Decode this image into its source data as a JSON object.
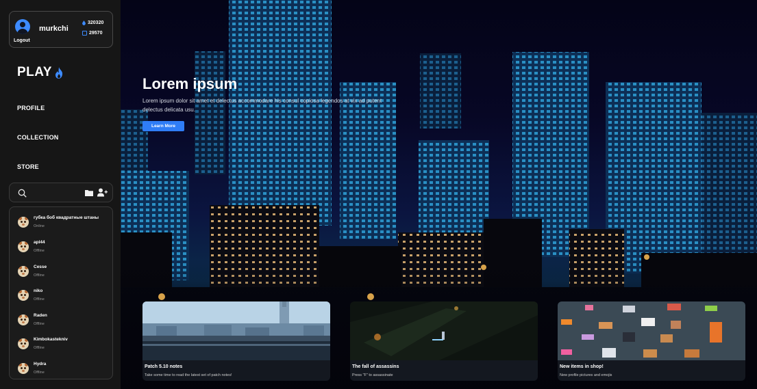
{
  "user": {
    "username": "murkchi",
    "logout_label": "Logout",
    "currency_drops": "320320",
    "currency_coins": "29570"
  },
  "logo": {
    "text": "PLAY"
  },
  "nav": {
    "profile": "PROFILE",
    "collection": "COLLECTION",
    "store": "STORE"
  },
  "search": {
    "placeholder": "",
    "value": ""
  },
  "friends": [
    {
      "name": "губка боб квадратные штаны",
      "status": "Online"
    },
    {
      "name": "apl44",
      "status": "Offline"
    },
    {
      "name": "Cesse",
      "status": "Offline"
    },
    {
      "name": "niko",
      "status": "Offline"
    },
    {
      "name": "Raden",
      "status": "Offline"
    },
    {
      "name": "Kimbokastekniv",
      "status": "Offline"
    },
    {
      "name": "Hydra",
      "status": "Offline"
    }
  ],
  "hero": {
    "title": "Lorem ipsum",
    "text": "Lorem ipsum dolor sit amet et delectus accommodare his consul copiosa legendos at vix ad putent delectus delicata usu.",
    "button": "Learn More"
  },
  "cards": [
    {
      "title": "Patch 5.10 notes",
      "subtitle": "Take some time to read the latest set of patch notes!"
    },
    {
      "title": "The fall of assassins",
      "subtitle": "Press \"F\" to assassinate"
    },
    {
      "title": "New items in shop!",
      "subtitle": "New profile pictures and emojis"
    }
  ],
  "colors": {
    "accent": "#2f7df6",
    "sidebar_bg": "#161616",
    "panel_border": "#3a3a3a"
  },
  "icons": {
    "avatar": "user-circle-icon",
    "drops": "drop-icon",
    "coins": "coin-icon",
    "logo": "flame-icon",
    "search": "search-icon",
    "folder": "folder-icon",
    "add_friend": "add-user-icon"
  }
}
